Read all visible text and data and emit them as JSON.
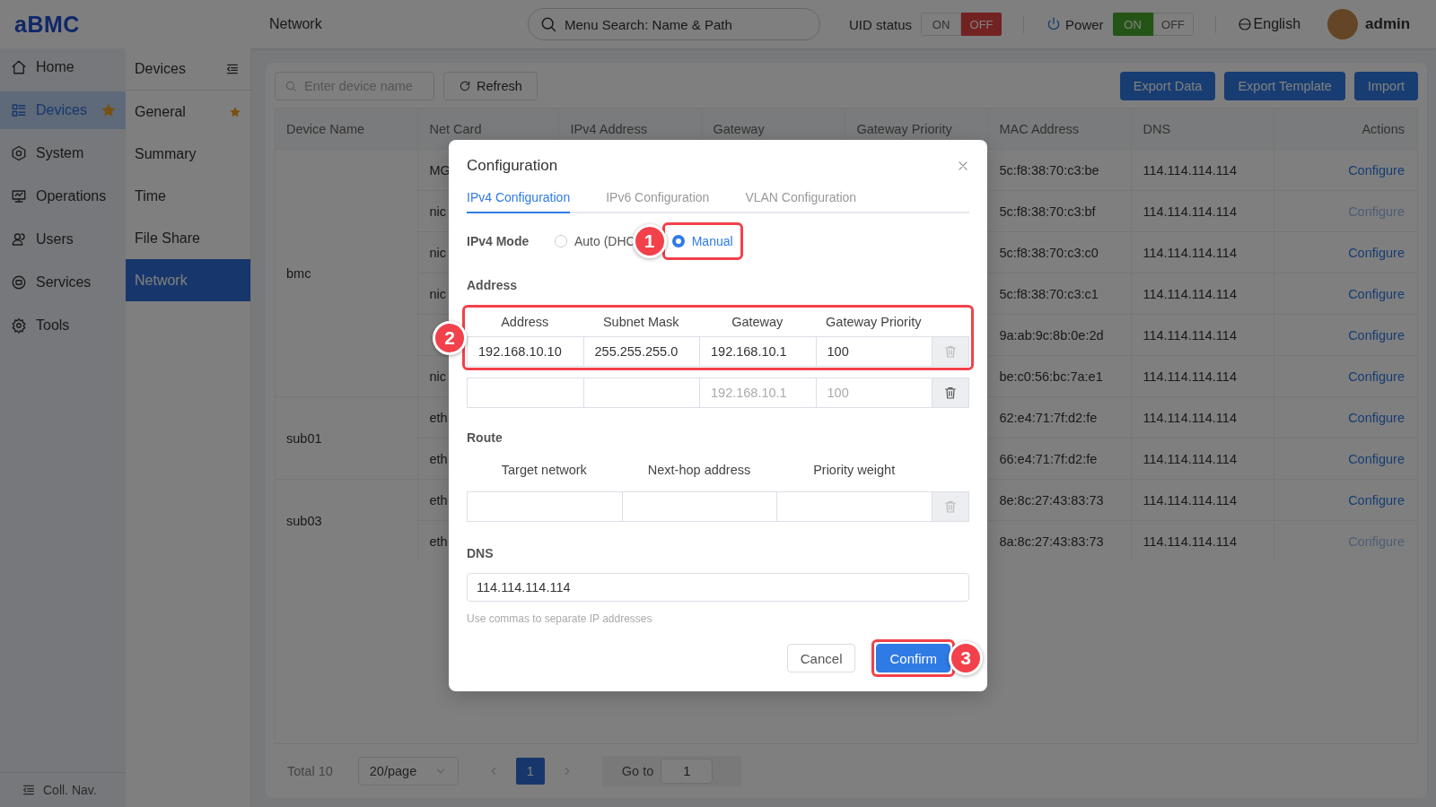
{
  "header": {
    "logo": "aBMC",
    "page_title": "Network",
    "search": {
      "placeholder": "Menu Search: Name & Path"
    },
    "toggles": [
      {
        "label": "UID status",
        "kind": "uid",
        "options": [
          {
            "label": "ON",
            "selected": false
          },
          {
            "label": "OFF",
            "selected": true
          }
        ]
      },
      {
        "label": "Power",
        "kind": "power",
        "options": [
          {
            "label": "ON",
            "selected": true
          },
          {
            "label": "OFF",
            "selected": false
          }
        ]
      }
    ],
    "language": "English",
    "user": "admin"
  },
  "nav": {
    "items": [
      {
        "label": "Home",
        "selected": false,
        "starred": false
      },
      {
        "label": "Devices",
        "selected": true,
        "starred": true
      },
      {
        "label": "System",
        "selected": false,
        "starred": false
      },
      {
        "label": "Operations",
        "selected": false,
        "starred": false
      },
      {
        "label": "Users",
        "selected": false,
        "starred": false
      },
      {
        "label": "Services",
        "selected": false,
        "starred": false
      },
      {
        "label": "Tools",
        "selected": false,
        "starred": false
      }
    ],
    "collapse": "Coll. Nav."
  },
  "subnav": {
    "title": "Devices",
    "items": [
      {
        "label": "General",
        "selected": false,
        "starred": true
      },
      {
        "label": "Summary",
        "selected": false,
        "starred": false
      },
      {
        "label": "Time",
        "selected": false,
        "starred": false
      },
      {
        "label": "File Share",
        "selected": false,
        "starred": false
      },
      {
        "label": "Network",
        "selected": true,
        "starred": false
      }
    ]
  },
  "toolbar": {
    "search": {
      "placeholder": "Enter device name"
    },
    "refresh": "Refresh",
    "buttons": [
      "Export Data",
      "Export Template",
      "Import"
    ]
  },
  "table": {
    "columns": [
      "Device Name",
      "Net Card",
      "IPv4 Address",
      "Gateway",
      "Gateway Priority",
      "MAC Address",
      "DNS",
      "Actions"
    ],
    "groups": [
      {
        "device": "bmc",
        "rows": [
          {
            "net_card": "MG",
            "mac": "5c:f8:38:70:c3:be",
            "dns": "114.114.114.114",
            "action": "Configure",
            "disabled": false
          },
          {
            "net_card": "nic",
            "mac": "5c:f8:38:70:c3:bf",
            "dns": "114.114.114.114",
            "action": "Configure",
            "disabled": true
          },
          {
            "net_card": "nic",
            "mac": "5c:f8:38:70:c3:c0",
            "dns": "114.114.114.114",
            "action": "Configure",
            "disabled": false
          },
          {
            "net_card": "nic",
            "mac": "5c:f8:38:70:c3:c1",
            "dns": "114.114.114.114",
            "action": "Configure",
            "disabled": false
          },
          {
            "mac": "9a:ab:9c:8b:0e:2d",
            "dns": "114.114.114.114",
            "action": "Configure",
            "disabled": false
          },
          {
            "net_card": "nic",
            "mac": "be:c0:56:bc:7a:e1",
            "dns": "114.114.114.114",
            "action": "Configure",
            "disabled": false
          }
        ]
      },
      {
        "device": "sub01",
        "rows": [
          {
            "net_card": "eth",
            "mac": "62:e4:71:7f:d2:fe",
            "dns": "114.114.114.114",
            "action": "Configure",
            "disabled": false
          },
          {
            "net_card": "eth",
            "mac": "66:e4:71:7f:d2:fe",
            "dns": "114.114.114.114",
            "action": "Configure",
            "disabled": false
          }
        ]
      },
      {
        "device": "sub03",
        "rows": [
          {
            "net_card": "eth",
            "mac": "8e:8c:27:43:83:73",
            "dns": "114.114.114.114",
            "action": "Configure",
            "disabled": false
          },
          {
            "net_card": "eth",
            "mac": "8a:8c:27:43:83:73",
            "dns": "114.114.114.114",
            "action": "Configure",
            "disabled": true
          }
        ]
      }
    ]
  },
  "pagination": {
    "total": "Total 10",
    "page_size": "20/page",
    "pages": [
      {
        "label": "1",
        "selected": true
      }
    ],
    "goto_label": "Go to",
    "goto_value": "1"
  },
  "dialog": {
    "title": "Configuration",
    "tabs": [
      {
        "label": "IPv4 Configuration",
        "selected": true
      },
      {
        "label": "IPv6 Configuration",
        "selected": false
      },
      {
        "label": "VLAN Configuration",
        "selected": false
      }
    ],
    "mode": {
      "label": "IPv4 Mode",
      "options": [
        {
          "label": "Auto (DHC",
          "selected": false
        },
        {
          "label": "Manual",
          "selected": true,
          "callout": "1"
        }
      ]
    },
    "address": {
      "title": "Address",
      "callout": "2",
      "columns": [
        "Address",
        "Subnet Mask",
        "Gateway",
        "Gateway Priority"
      ],
      "rows": [
        {
          "cells": [
            {
              "value": "192.168.10.10"
            },
            {
              "value": "255.255.255.0"
            },
            {
              "value": "192.168.10.1"
            },
            {
              "value": "100"
            }
          ],
          "delete_disabled": true
        },
        {
          "cells": [
            {},
            {},
            {
              "placeholder": "192.168.10.1"
            },
            {
              "placeholder": "100"
            }
          ],
          "delete_disabled": false
        }
      ]
    },
    "route": {
      "title": "Route",
      "columns": [
        "Target network",
        "Next-hop address",
        "Priority weight"
      ],
      "rows": [
        {
          "cells": [
            {},
            {},
            {}
          ],
          "delete_disabled": true
        }
      ]
    },
    "dns": {
      "label": "DNS",
      "value": "114.114.114.114",
      "hint": "Use commas to separate IP addresses"
    },
    "buttons": [
      {
        "label": "Cancel",
        "kind": "default"
      },
      {
        "label": "Confirm",
        "kind": "primary",
        "callout": "3"
      }
    ]
  }
}
